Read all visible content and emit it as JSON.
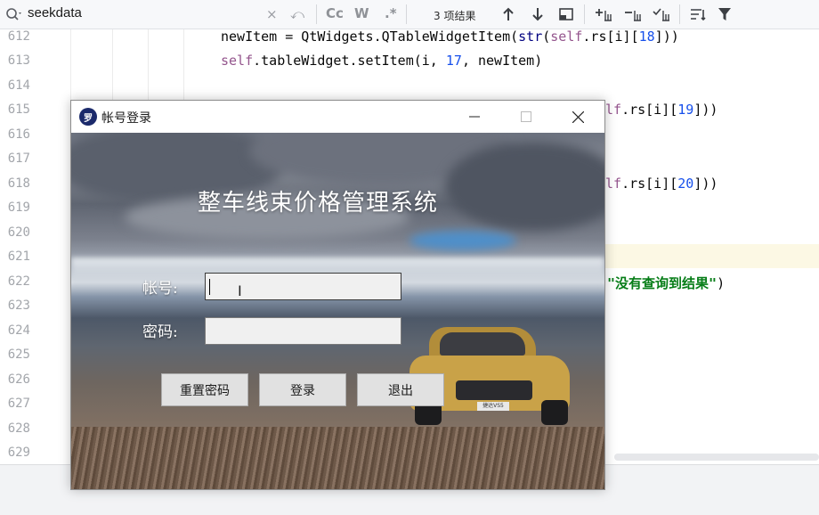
{
  "search": {
    "query": "seekdata",
    "clear_glyph": "×",
    "history_glyph": "⤺",
    "match_case_label": "Cc",
    "words_label": "W",
    "regex_label": ".*",
    "result_count": "3 项结果"
  },
  "editor": {
    "line_numbers": [
      "612",
      "613",
      "614",
      "615",
      "616",
      "617",
      "618",
      "619",
      "620",
      "621",
      "622",
      "623",
      "624",
      "625",
      "626",
      "627",
      "628",
      "629"
    ],
    "current_line": "621",
    "lines": {
      "l612_a": "newItem = QtWidgets.QTableWidgetItem(",
      "l612_b": "str",
      "l612_c": "(",
      "l612_d": "self",
      "l612_e": ".rs[i][",
      "l612_f": "18",
      "l612_g": "]))",
      "l613_a": "self",
      "l613_b": ".tableWidget.setItem(i, ",
      "l613_c": "17",
      "l613_d": ", newItem)",
      "l615_a": "lf",
      "l615_b": ".rs[i][",
      "l615_c": "19",
      "l615_d": "]))",
      "l618_a": "lf",
      "l618_b": ".rs[i][",
      "l618_c": "20",
      "l618_d": "]))",
      "l622_a": "\"没有查询到结果\"",
      "l622_b": ")"
    }
  },
  "dialog": {
    "icon_text": "罗",
    "title": "帐号登录",
    "minimize_glyph": "—",
    "maximize_glyph": "☐",
    "close_glyph": "✕",
    "system_title": "整车线束价格管理系统",
    "account_label": "帐号:",
    "password_label": "密码:",
    "account_value": "",
    "password_value": "",
    "cursor_glyph": "I",
    "car_plate": "捷达VS5",
    "buttons": {
      "reset": "重置密码",
      "login": "登录",
      "exit": "退出"
    }
  },
  "colors": {
    "keyword": "#94558d",
    "number": "#1750eb",
    "string": "#067d17",
    "current_line_bg": "#fcf8e4",
    "car_yellow": "#c9a248"
  }
}
